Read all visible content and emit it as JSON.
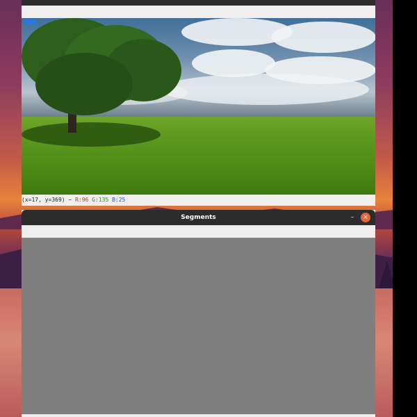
{
  "image_window": {
    "pixel_readout": {
      "coords": "(x=17, y=369) ~",
      "r": "R:96",
      "g": "G:135",
      "b": "B:25"
    }
  },
  "segments_window": {
    "title": "Segments",
    "minimize_icon": "minimize-icon",
    "close_icon": "close-icon",
    "minimize_glyph": "–",
    "close_glyph": "×",
    "canvas_color": "#7f7f7f"
  },
  "colors": {
    "titlebar": "#2c2c2c",
    "window_bg": "#efeeec",
    "close_button": "#e8623a"
  }
}
